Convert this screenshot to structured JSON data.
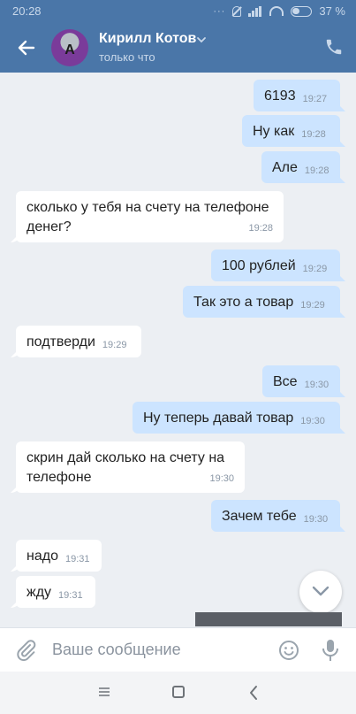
{
  "status": {
    "time": "20:28",
    "battery": "37 %"
  },
  "header": {
    "title": "Кирилл Котов",
    "subtitle": "только что"
  },
  "messages": [
    {
      "dir": "out",
      "text": "6193",
      "time": "19:27"
    },
    {
      "dir": "out",
      "text": "Ну как",
      "time": "19:28"
    },
    {
      "dir": "out",
      "text": "Але",
      "time": "19:28"
    },
    {
      "dir": "in",
      "text": "сколько у тебя на счету на телефоне денег?",
      "time": "19:28"
    },
    {
      "dir": "out",
      "text": "100 рублей",
      "time": "19:29"
    },
    {
      "dir": "out",
      "text": "Так это а товар",
      "time": "19:29"
    },
    {
      "dir": "in",
      "text": "подтверди",
      "time": "19:29"
    },
    {
      "dir": "out",
      "text": "Все",
      "time": "19:30"
    },
    {
      "dir": "out",
      "text": "Ну теперь давай товар",
      "time": "19:30"
    },
    {
      "dir": "in",
      "text": "скрин дай сколько на счету на телефоне",
      "time": "19:30"
    },
    {
      "dir": "out",
      "text": "Зачем тебе",
      "time": "19:30"
    },
    {
      "dir": "in",
      "text": "надо",
      "time": "19:31"
    },
    {
      "dir": "in",
      "text": "жду",
      "time": "19:31"
    }
  ],
  "composer": {
    "placeholder": "Ваше сообщение"
  },
  "icons": {
    "back": "arrow-left-icon",
    "phone": "phone-icon",
    "attach": "paperclip-icon",
    "emoji": "smiley-icon",
    "mic": "microphone-icon",
    "scroll_down": "chevron-down-icon"
  },
  "colors": {
    "header": "#4a76a8",
    "outgoing_bubble": "#cce4ff",
    "incoming_bubble": "#ffffff",
    "background": "#eceff3"
  }
}
